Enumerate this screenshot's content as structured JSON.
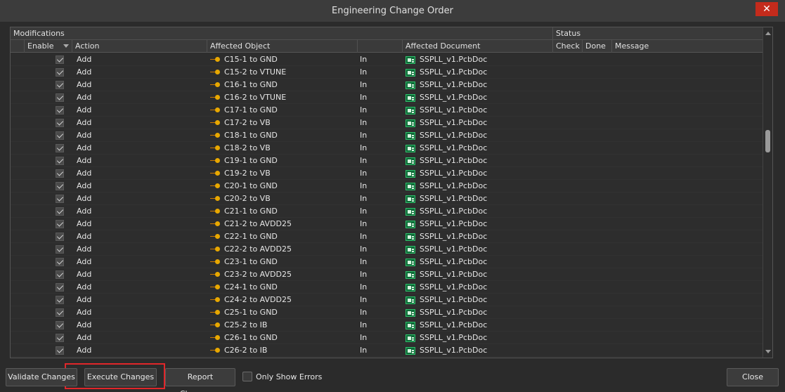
{
  "window": {
    "title": "Engineering Change Order",
    "close_glyph": "✕"
  },
  "groups": {
    "modifications": "Modifications",
    "status": "Status"
  },
  "columns": {
    "enable": "Enable",
    "action": "Action",
    "affected_object": "Affected Object",
    "affected_document": "Affected Document",
    "check": "Check",
    "done": "Done",
    "message": "Message"
  },
  "rows": [
    {
      "action": "Add",
      "object": "C15-1 to GND",
      "dir": "In",
      "doc": "SSPLL_v1.PcbDoc"
    },
    {
      "action": "Add",
      "object": "C15-2 to VTUNE",
      "dir": "In",
      "doc": "SSPLL_v1.PcbDoc"
    },
    {
      "action": "Add",
      "object": "C16-1 to GND",
      "dir": "In",
      "doc": "SSPLL_v1.PcbDoc"
    },
    {
      "action": "Add",
      "object": "C16-2 to VTUNE",
      "dir": "In",
      "doc": "SSPLL_v1.PcbDoc"
    },
    {
      "action": "Add",
      "object": "C17-1 to GND",
      "dir": "In",
      "doc": "SSPLL_v1.PcbDoc"
    },
    {
      "action": "Add",
      "object": "C17-2 to VB",
      "dir": "In",
      "doc": "SSPLL_v1.PcbDoc"
    },
    {
      "action": "Add",
      "object": "C18-1 to GND",
      "dir": "In",
      "doc": "SSPLL_v1.PcbDoc"
    },
    {
      "action": "Add",
      "object": "C18-2 to VB",
      "dir": "In",
      "doc": "SSPLL_v1.PcbDoc"
    },
    {
      "action": "Add",
      "object": "C19-1 to GND",
      "dir": "In",
      "doc": "SSPLL_v1.PcbDoc"
    },
    {
      "action": "Add",
      "object": "C19-2 to VB",
      "dir": "In",
      "doc": "SSPLL_v1.PcbDoc"
    },
    {
      "action": "Add",
      "object": "C20-1 to GND",
      "dir": "In",
      "doc": "SSPLL_v1.PcbDoc"
    },
    {
      "action": "Add",
      "object": "C20-2 to VB",
      "dir": "In",
      "doc": "SSPLL_v1.PcbDoc"
    },
    {
      "action": "Add",
      "object": "C21-1 to GND",
      "dir": "In",
      "doc": "SSPLL_v1.PcbDoc"
    },
    {
      "action": "Add",
      "object": "C21-2 to AVDD25",
      "dir": "In",
      "doc": "SSPLL_v1.PcbDoc"
    },
    {
      "action": "Add",
      "object": "C22-1 to GND",
      "dir": "In",
      "doc": "SSPLL_v1.PcbDoc"
    },
    {
      "action": "Add",
      "object": "C22-2 to AVDD25",
      "dir": "In",
      "doc": "SSPLL_v1.PcbDoc"
    },
    {
      "action": "Add",
      "object": "C23-1 to GND",
      "dir": "In",
      "doc": "SSPLL_v1.PcbDoc"
    },
    {
      "action": "Add",
      "object": "C23-2 to AVDD25",
      "dir": "In",
      "doc": "SSPLL_v1.PcbDoc"
    },
    {
      "action": "Add",
      "object": "C24-1 to GND",
      "dir": "In",
      "doc": "SSPLL_v1.PcbDoc"
    },
    {
      "action": "Add",
      "object": "C24-2 to AVDD25",
      "dir": "In",
      "doc": "SSPLL_v1.PcbDoc"
    },
    {
      "action": "Add",
      "object": "C25-1 to GND",
      "dir": "In",
      "doc": "SSPLL_v1.PcbDoc"
    },
    {
      "action": "Add",
      "object": "C25-2 to IB",
      "dir": "In",
      "doc": "SSPLL_v1.PcbDoc"
    },
    {
      "action": "Add",
      "object": "C26-1 to GND",
      "dir": "In",
      "doc": "SSPLL_v1.PcbDoc"
    },
    {
      "action": "Add",
      "object": "C26-2 to IB",
      "dir": "In",
      "doc": "SSPLL_v1.PcbDoc"
    }
  ],
  "buttons": {
    "validate": "Validate Changes",
    "execute": "Execute Changes",
    "report": "Report Changes...",
    "close": "Close"
  },
  "only_show_errors": {
    "label": "Only Show Errors",
    "checked": false
  },
  "colors": {
    "highlight": "#e0262a",
    "close_red": "#c42b1c",
    "pcb_icon": "#0e6b38",
    "net_icon": "#e8a800"
  }
}
